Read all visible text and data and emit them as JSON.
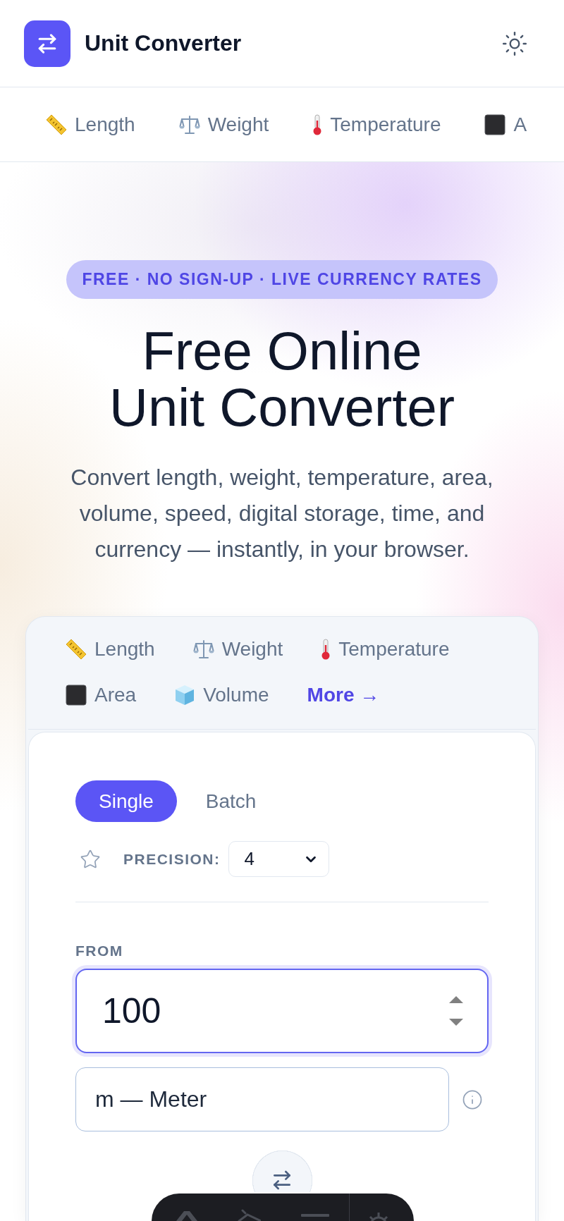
{
  "header": {
    "title": "Unit Converter"
  },
  "nav": [
    {
      "label": "Length"
    },
    {
      "label": "Weight"
    },
    {
      "label": "Temperature"
    },
    {
      "label": "A"
    }
  ],
  "hero": {
    "badge": "FREE · NO SIGN-UP · LIVE CURRENCY RATES",
    "title": "Free Online Unit Converter",
    "subtitle": "Convert length, weight, temperature, area, volume, speed, digital storage, time, and currency — instantly, in your browser."
  },
  "converter": {
    "category_tabs": [
      {
        "kind": "category",
        "label": "Length"
      },
      {
        "kind": "category",
        "label": "Weight"
      },
      {
        "kind": "category",
        "label": "Temperature"
      },
      {
        "kind": "category",
        "label": "Area"
      },
      {
        "kind": "category",
        "label": "Volume"
      },
      {
        "kind": "more",
        "label": "More →"
      }
    ],
    "modes": [
      {
        "label": "Single",
        "selected": true
      },
      {
        "label": "Batch",
        "selected": false
      }
    ],
    "favorite": {
      "starred": false
    },
    "precision": {
      "label": "PRECISION:",
      "value": "4"
    },
    "from": {
      "label": "FROM",
      "value": "100",
      "focused": true,
      "unit": "m — Meter"
    }
  }
}
